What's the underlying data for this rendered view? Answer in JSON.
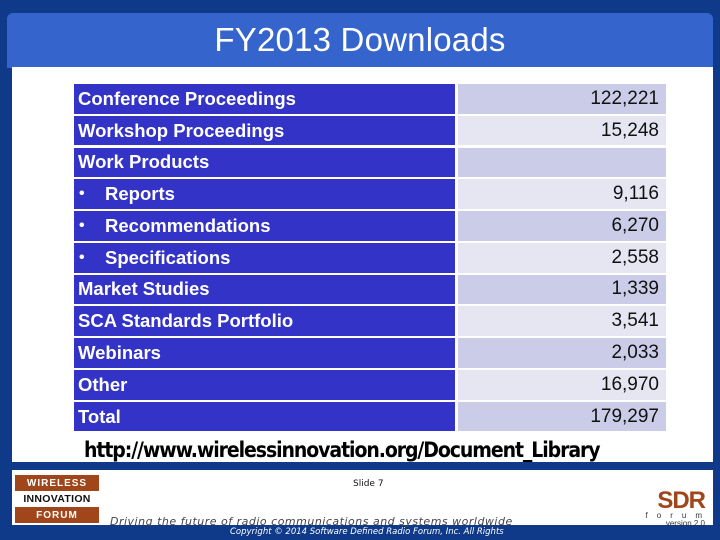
{
  "slide": {
    "title": "FY2013 Downloads",
    "url": "http://www.wirelessinnovation.org/Document_Library",
    "slide_number": "Slide 7",
    "tagline": "Driving the future of radio communications and systems worldwide",
    "copyright": "Copyright © 2014 Software Defined Radio Forum, Inc. All Rights",
    "colors": {
      "frame": "#0f3a8a",
      "title_bar": "#3565cc",
      "label_cell": "#3333c8",
      "value_shade_a": "#cbcce8",
      "value_shade_b": "#e6e6f3",
      "logo_brown": "#a0461a"
    }
  },
  "logos": {
    "wif": {
      "line1": "WIRELESS",
      "line2": "INNOVATION",
      "line3": "FORUM"
    },
    "sdr": {
      "name": "SDR",
      "sub": "forum",
      "version": "version 2.0"
    }
  },
  "table": {
    "rows": [
      {
        "label": "Conference Proceedings",
        "value": "122,221",
        "bullet": false
      },
      {
        "label": "Workshop Proceedings",
        "value": "15,248",
        "bullet": false
      },
      {
        "label": "Work Products",
        "value": "",
        "bullet": false
      },
      {
        "label": "Reports",
        "value": "9,116",
        "bullet": true
      },
      {
        "label": "Recommendations",
        "value": "6,270",
        "bullet": true
      },
      {
        "label": "Specifications",
        "value": "2,558",
        "bullet": true
      },
      {
        "label": "Market Studies",
        "value": "1,339",
        "bullet": false
      },
      {
        "label": "SCA Standards Portfolio",
        "value": "3,541",
        "bullet": false
      },
      {
        "label": "Webinars",
        "value": "2,033",
        "bullet": false
      },
      {
        "label": "Other",
        "value": "16,970",
        "bullet": false
      },
      {
        "label": "Total",
        "value": "179,297",
        "bullet": false
      }
    ],
    "bullet_glyph": "•"
  }
}
